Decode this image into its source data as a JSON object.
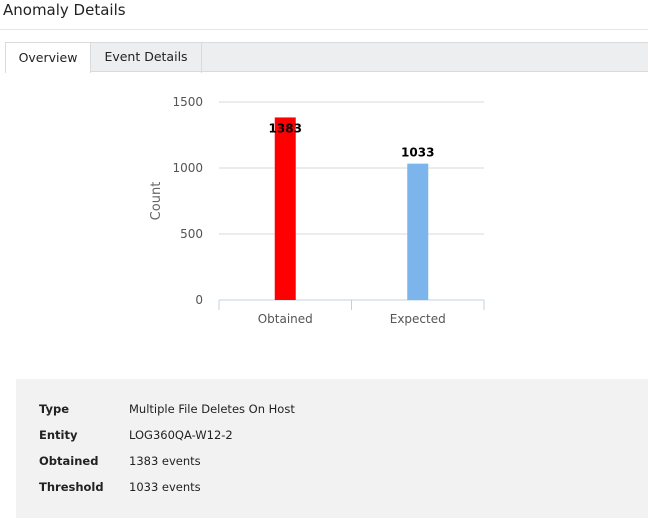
{
  "page": {
    "title": "Anomaly Details"
  },
  "tabs": [
    {
      "label": "Overview",
      "active": true
    },
    {
      "label": "Event Details",
      "active": false
    }
  ],
  "chart_data": {
    "type": "bar",
    "categories": [
      "Obtained",
      "Expected"
    ],
    "values": [
      1383,
      1033
    ],
    "data_labels": [
      "1383",
      "1033"
    ],
    "colors": [
      "#ff0000",
      "#7cb5ec"
    ],
    "ylabel": "Count",
    "xlabel": "",
    "ylim": [
      0,
      1500
    ],
    "yticks": [
      0,
      500,
      1000,
      1500
    ],
    "ytick_labels": [
      "0",
      "500",
      "1000",
      "1500"
    ],
    "grid": true
  },
  "details": [
    {
      "label": "Type",
      "value": "Multiple File Deletes On Host"
    },
    {
      "label": "Entity",
      "value": "LOG360QA-W12-2"
    },
    {
      "label": "Obtained",
      "value": "1383 events"
    },
    {
      "label": "Threshold",
      "value": "1033 events"
    }
  ]
}
